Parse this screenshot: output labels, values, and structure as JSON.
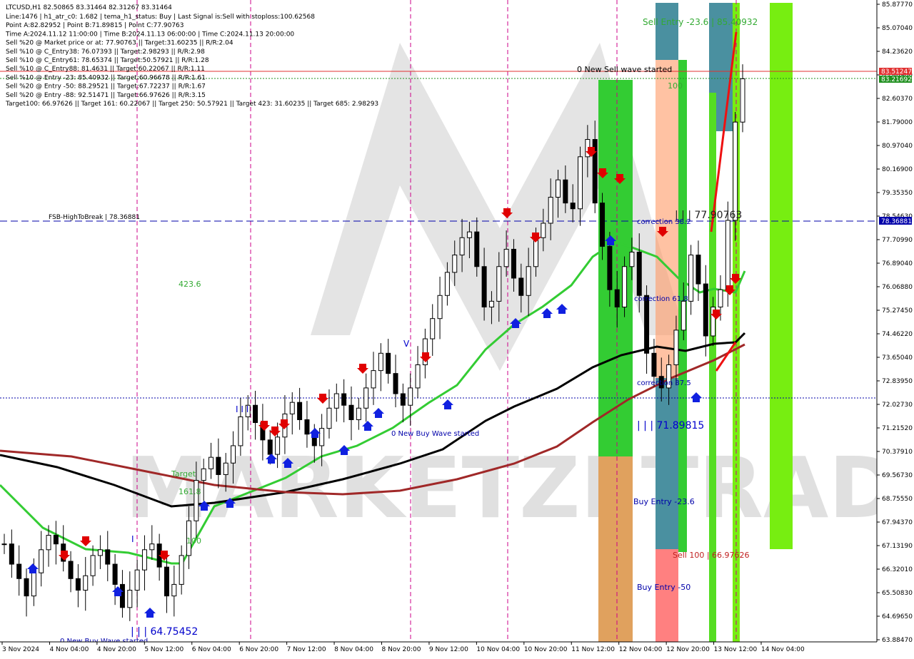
{
  "header": {
    "symbol_line": "LTCUSD,H1  82.50865 83.31464 82.31267 83.31464",
    "info_lines": [
      "Line:1476  |  h1_atr_c0: 1.682  |  tema_h1_status: Buy  |  Last Signal is:Sell with stoploss:100.62568",
      "Point A:82.82952  |  Point B:71.89815  |  Point C:77.90763",
      "Time A:2024.11.12 11:00:00  |  Time B:2024.11.13 06:00:00  |  Time C:2024.11.13 20:00:00",
      "Sell %20 @ Market price or at: 77.90763  ||  Target:31.60235  ||  R/R:2.04",
      "Sell %10 @ C_Entry38: 76.07393  ||  Target:2.98293  ||  R/R:2.98",
      "Sell %10 @ C_Entry61: 78.65374  ||  Target:50.57921  ||  R/R:1.28",
      "Sell %10 @ C_Entry88: 81.4631  ||  Target:60.22067  ||  R/R:1.11",
      "Sell %10 @ Entry -23: 85.40932  ||  Target:60.96678  ||  R/R:1.61",
      "Sell %20 @ Entry -50: 88.29521  ||  Target:67.72237  ||  R/R:1.67",
      "Sell %20 @ Entry -88: 92.51471  ||  Target:66.97626  ||  R/R:3.15",
      "Target100: 66.97626  ||  Target 161: 60.22067  ||  Target 250: 50.57921  ||  Target 423: 31.60235  ||  Target 685: 2.98293"
    ]
  },
  "annotations": {
    "sell_entry": "Sell Entry -23.6 | 85.40932",
    "new_sell_wave": "0 New Sell wave started",
    "label_100_top": "100",
    "fsb": "FSB-HighToBreak | 78.36881",
    "point_c": "| | | 77.90763",
    "correction_38": "correction 38.2",
    "correction_61": "correction 61.8",
    "correction_87": "correction 87.5",
    "label_423": "423.6",
    "point_b": "| | | 71.89815",
    "new_buy_wave_mid": "0 New Buy Wave started",
    "buy_entry_23": "Buy Entry -23.6",
    "sell_100": "Sell 100 | 66.97626",
    "buy_entry_50": "Buy Entry -50",
    "point_low": "| | | 64.75452",
    "new_buy_wave_bottom": "0 New Buy Wave started",
    "target_label": "Target",
    "label_161": "161.8",
    "label_100_low": "100",
    "iii": "I I I",
    "v_label": "V",
    "i_label": "I",
    "watermark": "MARKETZI TRADE"
  },
  "price_tags": {
    "red": "83.51247",
    "green": "83.21692",
    "blue": "78.36881"
  },
  "y_axis": [
    "85.87770",
    "85.07040",
    "84.23620",
    "83.40900",
    "82.60370",
    "81.79000",
    "80.97040",
    "80.16900",
    "79.35350",
    "78.54630",
    "77.70990",
    "76.89040",
    "76.06880",
    "75.27450",
    "74.46220",
    "73.65040",
    "72.83950",
    "72.02730",
    "71.21520",
    "70.37910",
    "69.56730",
    "68.75550",
    "67.94370",
    "67.13190",
    "66.32010",
    "65.50830",
    "64.69650",
    "63.88470"
  ],
  "x_axis": [
    "3 Nov 2024",
    "4 Nov 04:00",
    "4 Nov 20:00",
    "5 Nov 12:00",
    "6 Nov 04:00",
    "6 Nov 20:00",
    "7 Nov 12:00",
    "8 Nov 04:00",
    "8 Nov 20:00",
    "9 Nov 12:00",
    "10 Nov 04:00",
    "10 Nov 20:00",
    "11 Nov 12:00",
    "12 Nov 04:00",
    "12 Nov 20:00",
    "13 Nov 12:00",
    "14 Nov 04:00"
  ],
  "colors": {
    "bull_zone": "#33cc33",
    "bear_zone": "#ff8080",
    "teal_zone": "#4a90a0",
    "ema_green": "#33cc33",
    "ma_black": "#000000",
    "ma_brown": "#a02828",
    "candle": "#000000",
    "sell_arrow": "#e00000",
    "buy_arrow": "#1020e0",
    "session_line": "#cc0088",
    "fsb_line": "#0000aa"
  },
  "chart_data": {
    "type": "candlestick",
    "symbol": "LTCUSD",
    "timeframe": "H1",
    "ohlc_last": [
      82.50865,
      83.31464,
      82.31267,
      83.31464
    ],
    "ylim": [
      63.8847,
      85.8777
    ],
    "levels": [
      {
        "name": "FSB-HighToBreak",
        "value": 78.36881
      },
      {
        "name": "Sell Entry -23.6",
        "value": 85.40932
      },
      {
        "name": "Sell 100",
        "value": 66.97626
      },
      {
        "name": "Point C",
        "value": 77.90763
      },
      {
        "name": "Point B",
        "value": 71.89815
      },
      {
        "name": "Point A",
        "value": 82.82952
      }
    ],
    "close_series_approx": [
      67.2,
      66.5,
      66.0,
      65.4,
      66.2,
      67.0,
      67.5,
      67.2,
      66.6,
      66.0,
      65.6,
      66.1,
      66.8,
      67.0,
      66.5,
      65.8,
      65.0,
      65.6,
      66.3,
      67.0,
      67.2,
      66.4,
      65.4,
      65.8,
      66.8,
      68.0,
      69.4,
      69.8,
      70.2,
      69.6,
      70.0,
      70.6,
      71.6,
      72.0,
      71.4,
      70.8,
      70.3,
      70.9,
      71.7,
      72.1,
      71.5,
      71.0,
      70.6,
      71.2,
      71.9,
      72.4,
      72.0,
      71.5,
      71.9,
      72.6,
      73.2,
      73.8,
      73.1,
      72.4,
      72.0,
      72.6,
      73.4,
      74.3,
      75.0,
      75.8,
      76.6,
      77.2,
      77.8,
      78.0,
      76.8,
      75.4,
      75.6,
      76.8,
      77.4,
      76.4,
      75.8,
      76.8,
      77.8,
      78.3,
      79.2,
      79.8,
      79.0,
      78.8,
      80.6,
      81.2,
      79.0,
      77.5,
      76.0,
      75.4,
      76.8,
      77.3,
      75.8,
      73.8,
      73.0,
      72.6,
      73.4,
      74.6,
      75.6,
      77.2,
      76.2,
      74.4,
      75.4,
      76.0,
      78.4,
      81.8,
      83.3
    ]
  }
}
